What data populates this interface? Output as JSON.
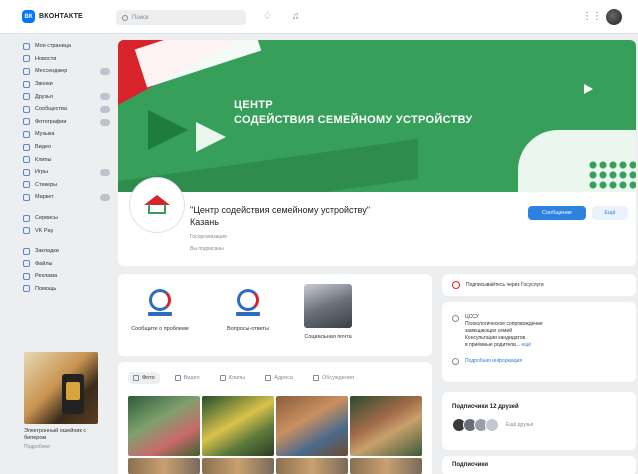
{
  "topbar": {
    "logo_mark": "ВК",
    "logo_text": "ВКОНТАКТЕ",
    "search_placeholder": "Поиск",
    "bell_icon": "bell-icon",
    "music_icon": "music-icon",
    "grid_icon": "grid-icon"
  },
  "sidebar": {
    "items": [
      {
        "label": "Моя страница",
        "badge": false
      },
      {
        "label": "Новости",
        "badge": false
      },
      {
        "label": "Мессенджер",
        "badge": true
      },
      {
        "label": "Звонки",
        "badge": false
      },
      {
        "label": "Друзья",
        "badge": true
      },
      {
        "label": "Сообщества",
        "badge": true
      },
      {
        "label": "Фотографии",
        "badge": true
      },
      {
        "label": "Музыка",
        "badge": false
      },
      {
        "label": "Видео",
        "badge": false
      },
      {
        "label": "Клипы",
        "badge": false
      },
      {
        "label": "Игры",
        "badge": true
      },
      {
        "label": "Стикеры",
        "badge": false
      },
      {
        "label": "Маркет",
        "badge": true
      }
    ],
    "items2": [
      {
        "label": "Сервисы"
      },
      {
        "label": "VK Pay"
      }
    ],
    "items3": [
      {
        "label": "Закладки"
      },
      {
        "label": "Файлы"
      },
      {
        "label": "Реклама"
      },
      {
        "label": "Помощь"
      }
    ],
    "ad": {
      "title": "Электронный ошейник с бипером",
      "sub": "Подробнее"
    }
  },
  "cover": {
    "title_line1": "ЦЕНТР",
    "title_line2": "СОДЕЙСТВИЯ СЕМЕЙНОМУ УСТРОЙСТВУ"
  },
  "group": {
    "name": "\"Центр содействия семейному устройству\" Казань",
    "meta1": "Госорганизация",
    "meta2": "Вы подписаны",
    "primary_button": "Сообщение",
    "secondary_button": "Ещё"
  },
  "links": [
    {
      "label": "Сообщите о проблеме"
    },
    {
      "label": "Вопросы-ответы"
    },
    {
      "label": "Социальная почта"
    }
  ],
  "tabs": [
    {
      "label": "Фото",
      "active": true
    },
    {
      "label": "Видео",
      "active": false
    },
    {
      "label": "Клипы",
      "active": false
    },
    {
      "label": "Адреса",
      "active": false
    },
    {
      "label": "Обсуждения",
      "active": false
    }
  ],
  "right": {
    "notify_text": "Подписывайтесь через Госуслуги",
    "info_line1": "ЦССУ",
    "info_line2": "Психологическое сопровождение",
    "info_line3": "замещающих семей",
    "info_line4": "Консультации кандидатов",
    "info_line5": "в приёмные родители...",
    "info_more": "ещё",
    "info_link": "Подробная информация",
    "friends_head": "Подписчики 12 друзей",
    "friends_text": "Ещё друзья",
    "subs_head": "Подписчики"
  },
  "colors": {
    "accent": "#2d81e0",
    "cover_green": "#36a05a",
    "cover_red": "#d8232a"
  }
}
